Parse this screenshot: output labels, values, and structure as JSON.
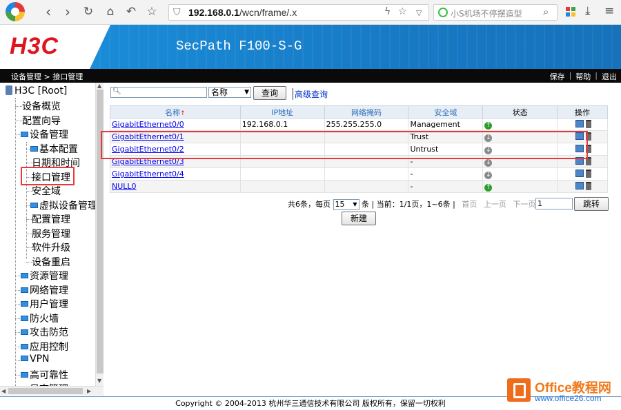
{
  "browser": {
    "address_host": "192.168.0.1",
    "address_path": "/wcn/frame/.x",
    "search_text": "小S机场不停摆造型",
    "colors": {
      "tab_bar": "#f3f3f3"
    }
  },
  "header": {
    "logo": "H3C",
    "product": "SecPath F100-S-G",
    "brand_color": "#e0141e",
    "banner_color": "#1a8cd8"
  },
  "topbar": {
    "breadcrumb": "设备管理 > 接口管理",
    "links": [
      "保存",
      "帮助",
      "退出"
    ]
  },
  "tree": {
    "root": "H3C [Root]",
    "items": [
      {
        "label": "设备概览",
        "level": 1,
        "folder": false
      },
      {
        "label": "配置向导",
        "level": 1,
        "folder": false
      },
      {
        "label": "设备管理",
        "level": 1,
        "folder": true
      },
      {
        "label": "基本配置",
        "level": 2,
        "folder": true
      },
      {
        "label": "日期和时间",
        "level": 2,
        "folder": false
      },
      {
        "label": "接口管理",
        "level": 2,
        "folder": false
      },
      {
        "label": "安全域",
        "level": 2,
        "folder": false
      },
      {
        "label": "虚拟设备管理",
        "level": 2,
        "folder": true
      },
      {
        "label": "配置管理",
        "level": 2,
        "folder": false
      },
      {
        "label": "服务管理",
        "level": 2,
        "folder": false
      },
      {
        "label": "软件升级",
        "level": 2,
        "folder": false
      },
      {
        "label": "设备重启",
        "level": 2,
        "folder": false
      },
      {
        "label": "资源管理",
        "level": 1,
        "folder": true
      },
      {
        "label": "网络管理",
        "level": 1,
        "folder": true
      },
      {
        "label": "用户管理",
        "level": 1,
        "folder": true
      },
      {
        "label": "防火墙",
        "level": 1,
        "folder": true
      },
      {
        "label": "攻击防范",
        "level": 1,
        "folder": true
      },
      {
        "label": "应用控制",
        "level": 1,
        "folder": true
      },
      {
        "label": "VPN",
        "level": 1,
        "folder": true
      },
      {
        "label": "高可靠性",
        "level": 1,
        "folder": true
      },
      {
        "label": "日志管理",
        "level": 1,
        "folder": true
      }
    ]
  },
  "query": {
    "input_value": "",
    "field_select": "名称",
    "search_button": "查询",
    "advanced_link": "高级查询"
  },
  "table": {
    "columns": [
      "名称",
      "IP地址",
      "网络掩码",
      "安全域",
      "状态",
      "操作"
    ],
    "rows": [
      {
        "name": "GigabitEthernet0/0",
        "ip": "192.168.0.1",
        "mask": "255.255.255.0",
        "zone": "Management",
        "status": "up"
      },
      {
        "name": "GigabitEthernet0/1",
        "ip": "",
        "mask": "",
        "zone": "Trust",
        "status": "down"
      },
      {
        "name": "GigabitEthernet0/2",
        "ip": "",
        "mask": "",
        "zone": "Untrust",
        "status": "down"
      },
      {
        "name": "GigabitEthernet0/3",
        "ip": "",
        "mask": "",
        "zone": "-",
        "status": "down"
      },
      {
        "name": "GigabitEthernet0/4",
        "ip": "",
        "mask": "",
        "zone": "-",
        "status": "down"
      },
      {
        "name": "NULL0",
        "ip": "",
        "mask": "",
        "zone": "-",
        "status": "up"
      }
    ]
  },
  "pager": {
    "total_label": "共6条，每页",
    "page_size": "15",
    "after_size": "条 | 当前：1/1页，1~6条 |",
    "first": "首页",
    "prev": "上一页",
    "next": "下一页",
    "last": "尾页",
    "page_input": "1",
    "jump_button": "跳转"
  },
  "new_button": "新建",
  "footer": "Copyright © 2004-2013 杭州华三通信技术有限公司 版权所有，保留一切权利",
  "watermark": {
    "title": "Office教程网",
    "url": "www.office26.com"
  }
}
